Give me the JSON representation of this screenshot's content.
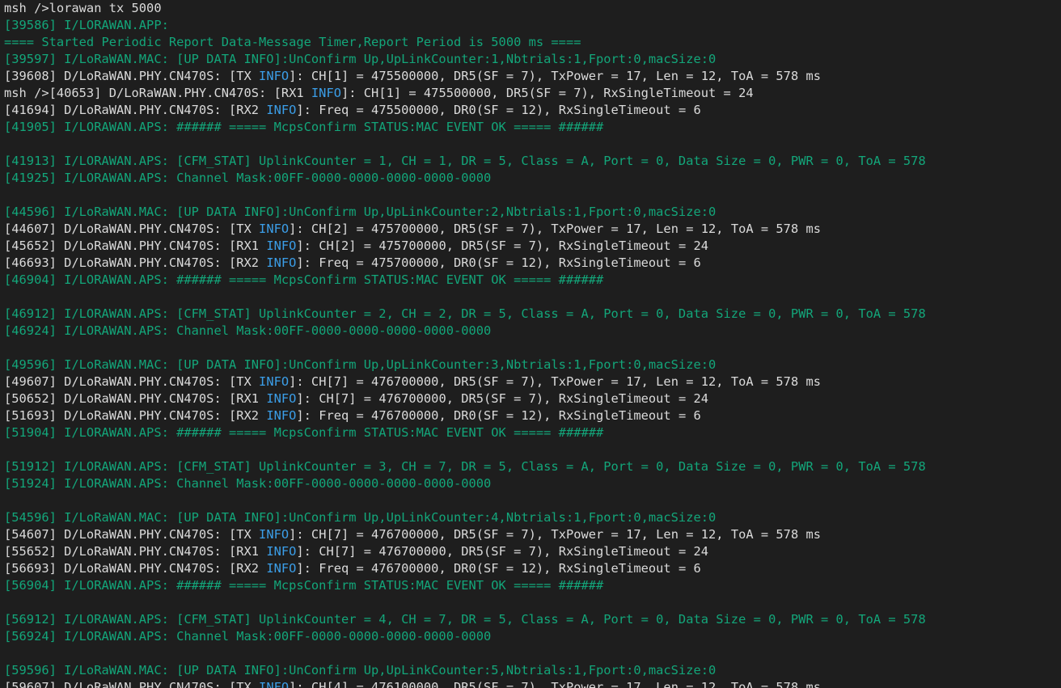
{
  "colors": {
    "background": "#1e1e1e",
    "default_text": "#dadada",
    "info_green": "#13a67a",
    "info_blue": "#3b9ee8"
  },
  "lines": [
    {
      "segments": [
        {
          "text": "msh />lorawan tx 5000",
          "color": "w"
        }
      ]
    },
    {
      "segments": [
        {
          "text": "[39586] I/LORAWAN.APP:",
          "color": "g"
        }
      ]
    },
    {
      "segments": [
        {
          "text": "==== Started Periodic Report Data-Message Timer,Report Period is 5000 ms ====",
          "color": "g"
        }
      ]
    },
    {
      "segments": [
        {
          "text": "[39597] I/LoRaWAN.MAC: [UP DATA INFO]:UnConfirm Up,UpLinkCounter:1,Nbtrials:1,Fport:0,macSize:0",
          "color": "g"
        }
      ]
    },
    {
      "segments": [
        {
          "text": "[39608] D/LoRaWAN.PHY.CN470S: [TX ",
          "color": "w"
        },
        {
          "text": "INFO",
          "color": "b"
        },
        {
          "text": "]: CH[1] = 475500000, DR5(SF = 7), TxPower = 17, Len = 12, ToA = 578 ms",
          "color": "w"
        }
      ]
    },
    {
      "segments": [
        {
          "text": "msh />[40653] D/LoRaWAN.PHY.CN470S: [RX1 ",
          "color": "w"
        },
        {
          "text": "INFO",
          "color": "b"
        },
        {
          "text": "]: CH[1] = 475500000, DR5(SF = 7), RxSingleTimeout = 24",
          "color": "w"
        }
      ]
    },
    {
      "segments": [
        {
          "text": "[41694] D/LoRaWAN.PHY.CN470S: [RX2 ",
          "color": "w"
        },
        {
          "text": "INFO",
          "color": "b"
        },
        {
          "text": "]: Freq = 475500000, DR0(SF = 12), RxSingleTimeout = 6",
          "color": "w"
        }
      ]
    },
    {
      "segments": [
        {
          "text": "[41905] I/LORAWAN.APS: ###### ===== McpsConfirm STATUS:MAC EVENT OK ===== ######",
          "color": "g"
        }
      ]
    },
    {
      "segments": [
        {
          "text": "",
          "color": "w"
        }
      ]
    },
    {
      "segments": [
        {
          "text": "[41913] I/LORAWAN.APS: [CFM_STAT] UplinkCounter = 1, CH = 1, DR = 5, Class = A, Port = 0, Data Size = 0, PWR = 0, ToA = 578",
          "color": "g"
        }
      ]
    },
    {
      "segments": [
        {
          "text": "[41925] I/LORAWAN.APS: Channel Mask:00FF-0000-0000-0000-0000-0000",
          "color": "g"
        }
      ]
    },
    {
      "segments": [
        {
          "text": "",
          "color": "w"
        }
      ]
    },
    {
      "segments": [
        {
          "text": "[44596] I/LoRaWAN.MAC: [UP DATA INFO]:UnConfirm Up,UpLinkCounter:2,Nbtrials:1,Fport:0,macSize:0",
          "color": "g"
        }
      ]
    },
    {
      "segments": [
        {
          "text": "[44607] D/LoRaWAN.PHY.CN470S: [TX ",
          "color": "w"
        },
        {
          "text": "INFO",
          "color": "b"
        },
        {
          "text": "]: CH[2] = 475700000, DR5(SF = 7), TxPower = 17, Len = 12, ToA = 578 ms",
          "color": "w"
        }
      ]
    },
    {
      "segments": [
        {
          "text": "[45652] D/LoRaWAN.PHY.CN470S: [RX1 ",
          "color": "w"
        },
        {
          "text": "INFO",
          "color": "b"
        },
        {
          "text": "]: CH[2] = 475700000, DR5(SF = 7), RxSingleTimeout = 24",
          "color": "w"
        }
      ]
    },
    {
      "segments": [
        {
          "text": "[46693] D/LoRaWAN.PHY.CN470S: [RX2 ",
          "color": "w"
        },
        {
          "text": "INFO",
          "color": "b"
        },
        {
          "text": "]: Freq = 475700000, DR0(SF = 12), RxSingleTimeout = 6",
          "color": "w"
        }
      ]
    },
    {
      "segments": [
        {
          "text": "[46904] I/LORAWAN.APS: ###### ===== McpsConfirm STATUS:MAC EVENT OK ===== ######",
          "color": "g"
        }
      ]
    },
    {
      "segments": [
        {
          "text": "",
          "color": "w"
        }
      ]
    },
    {
      "segments": [
        {
          "text": "[46912] I/LORAWAN.APS: [CFM_STAT] UplinkCounter = 2, CH = 2, DR = 5, Class = A, Port = 0, Data Size = 0, PWR = 0, ToA = 578",
          "color": "g"
        }
      ]
    },
    {
      "segments": [
        {
          "text": "[46924] I/LORAWAN.APS: Channel Mask:00FF-0000-0000-0000-0000-0000",
          "color": "g"
        }
      ]
    },
    {
      "segments": [
        {
          "text": "",
          "color": "w"
        }
      ]
    },
    {
      "segments": [
        {
          "text": "[49596] I/LoRaWAN.MAC: [UP DATA INFO]:UnConfirm Up,UpLinkCounter:3,Nbtrials:1,Fport:0,macSize:0",
          "color": "g"
        }
      ]
    },
    {
      "segments": [
        {
          "text": "[49607] D/LoRaWAN.PHY.CN470S: [TX ",
          "color": "w"
        },
        {
          "text": "INFO",
          "color": "b"
        },
        {
          "text": "]: CH[7] = 476700000, DR5(SF = 7), TxPower = 17, Len = 12, ToA = 578 ms",
          "color": "w"
        }
      ]
    },
    {
      "segments": [
        {
          "text": "[50652] D/LoRaWAN.PHY.CN470S: [RX1 ",
          "color": "w"
        },
        {
          "text": "INFO",
          "color": "b"
        },
        {
          "text": "]: CH[7] = 476700000, DR5(SF = 7), RxSingleTimeout = 24",
          "color": "w"
        }
      ]
    },
    {
      "segments": [
        {
          "text": "[51693] D/LoRaWAN.PHY.CN470S: [RX2 ",
          "color": "w"
        },
        {
          "text": "INFO",
          "color": "b"
        },
        {
          "text": "]: Freq = 476700000, DR0(SF = 12), RxSingleTimeout = 6",
          "color": "w"
        }
      ]
    },
    {
      "segments": [
        {
          "text": "[51904] I/LORAWAN.APS: ###### ===== McpsConfirm STATUS:MAC EVENT OK ===== ######",
          "color": "g"
        }
      ]
    },
    {
      "segments": [
        {
          "text": "",
          "color": "w"
        }
      ]
    },
    {
      "segments": [
        {
          "text": "[51912] I/LORAWAN.APS: [CFM_STAT] UplinkCounter = 3, CH = 7, DR = 5, Class = A, Port = 0, Data Size = 0, PWR = 0, ToA = 578",
          "color": "g"
        }
      ]
    },
    {
      "segments": [
        {
          "text": "[51924] I/LORAWAN.APS: Channel Mask:00FF-0000-0000-0000-0000-0000",
          "color": "g"
        }
      ]
    },
    {
      "segments": [
        {
          "text": "",
          "color": "w"
        }
      ]
    },
    {
      "segments": [
        {
          "text": "[54596] I/LoRaWAN.MAC: [UP DATA INFO]:UnConfirm Up,UpLinkCounter:4,Nbtrials:1,Fport:0,macSize:0",
          "color": "g"
        }
      ]
    },
    {
      "segments": [
        {
          "text": "[54607] D/LoRaWAN.PHY.CN470S: [TX ",
          "color": "w"
        },
        {
          "text": "INFO",
          "color": "b"
        },
        {
          "text": "]: CH[7] = 476700000, DR5(SF = 7), TxPower = 17, Len = 12, ToA = 578 ms",
          "color": "w"
        }
      ]
    },
    {
      "segments": [
        {
          "text": "[55652] D/LoRaWAN.PHY.CN470S: [RX1 ",
          "color": "w"
        },
        {
          "text": "INFO",
          "color": "b"
        },
        {
          "text": "]: CH[7] = 476700000, DR5(SF = 7), RxSingleTimeout = 24",
          "color": "w"
        }
      ]
    },
    {
      "segments": [
        {
          "text": "[56693] D/LoRaWAN.PHY.CN470S: [RX2 ",
          "color": "w"
        },
        {
          "text": "INFO",
          "color": "b"
        },
        {
          "text": "]: Freq = 476700000, DR0(SF = 12), RxSingleTimeout = 6",
          "color": "w"
        }
      ]
    },
    {
      "segments": [
        {
          "text": "[56904] I/LORAWAN.APS: ###### ===== McpsConfirm STATUS:MAC EVENT OK ===== ######",
          "color": "g"
        }
      ]
    },
    {
      "segments": [
        {
          "text": "",
          "color": "w"
        }
      ]
    },
    {
      "segments": [
        {
          "text": "[56912] I/LORAWAN.APS: [CFM_STAT] UplinkCounter = 4, CH = 7, DR = 5, Class = A, Port = 0, Data Size = 0, PWR = 0, ToA = 578",
          "color": "g"
        }
      ]
    },
    {
      "segments": [
        {
          "text": "[56924] I/LORAWAN.APS: Channel Mask:00FF-0000-0000-0000-0000-0000",
          "color": "g"
        }
      ]
    },
    {
      "segments": [
        {
          "text": "",
          "color": "w"
        }
      ]
    },
    {
      "segments": [
        {
          "text": "[59596] I/LoRaWAN.MAC: [UP DATA INFO]:UnConfirm Up,UpLinkCounter:5,Nbtrials:1,Fport:0,macSize:0",
          "color": "g"
        }
      ]
    },
    {
      "segments": [
        {
          "text": "[59607] D/LoRaWAN.PHY.CN470S: [TX ",
          "color": "w"
        },
        {
          "text": "INFO",
          "color": "b"
        },
        {
          "text": "]: CH[4] = 476100000, DR5(SF = 7), TxPower = 17, Len = 12, ToA = 578 ms",
          "color": "w"
        }
      ]
    }
  ]
}
